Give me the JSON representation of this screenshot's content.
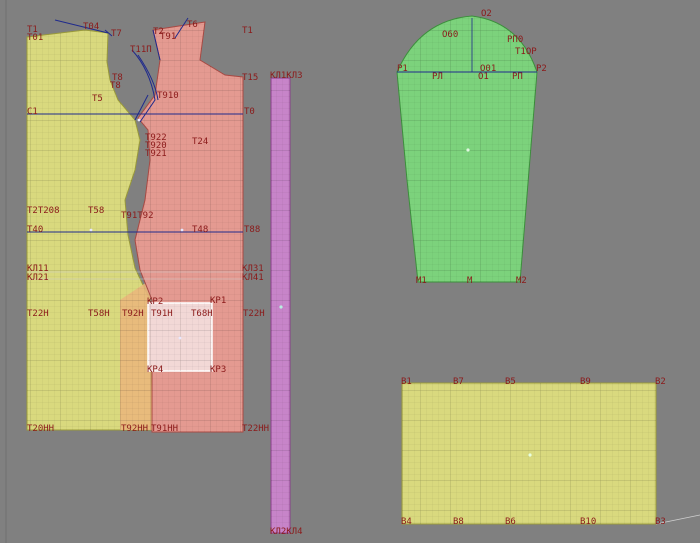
{
  "colors": {
    "background": "#808080",
    "grid_major": "#777777",
    "piece_yellow": "#d8d87a",
    "piece_red": "#e59a92",
    "piece_green": "#78d278",
    "piece_violet": "#c784c9",
    "piece_orange": "#e8b878",
    "construction_line": "#1f2a8c",
    "label": "#8b1a1a"
  },
  "pieces": {
    "back_piece": "back-bodice-piece",
    "front_piece": "front-bodice-piece",
    "sleeve_piece": "sleeve-piece",
    "strip_piece": "facing-strip-piece",
    "rect_piece": "rectangle-piece",
    "pocket": "pocket-square"
  },
  "labels": {
    "t1": "T1",
    "t01": "T01",
    "t04": "T04",
    "t7": "T7",
    "t2": "T2",
    "t6": "T6",
    "t91": "T91",
    "t1_right": "T1",
    "t11p": "T11П",
    "t8a": "T8",
    "t8b": "T8",
    "t15": "T15",
    "t5": "T5",
    "t910": "T910",
    "t0": "T0",
    "t_c": "C1",
    "t922": "T922",
    "t920": "T920",
    "t921": "T921",
    "t24": "T24",
    "t2208": "T2T208",
    "t58": "T58",
    "t913": "T91T92",
    "t40": "T40",
    "t48": "T48",
    "t88": "T88",
    "kl11": "КЛ11",
    "kl21": "КЛ21",
    "kl31": "КЛ31",
    "kl41": "КЛ41",
    "t22h_left": "T22H",
    "t58h": "T58H",
    "t92h": "T92H",
    "t91h": "T91H",
    "t68h": "T68H",
    "t22h_right": "T22H",
    "kp2": "КР2",
    "kp1": "КР1",
    "kp4": "КР4",
    "kp3": "КР3",
    "t20hh": "T20HH",
    "t92hh": "T92HH",
    "t91hh": "T91HH",
    "t22hh": "T22HH",
    "kl1_kl3": "КЛ1КЛ3",
    "kl2_kl4": "КЛ2КЛ4",
    "o2": "O2",
    "o60": "O60",
    "rp0": "РП0",
    "t10p": "T1ОР",
    "p1": "P1",
    "rl": "РЛ",
    "o01": "O01",
    "o1": "O1",
    "rp": "РП",
    "p2": "P2",
    "m1": "M1",
    "m": "M",
    "m2": "M2",
    "b1": "B1",
    "b7": "B7",
    "b5": "B5",
    "b9": "B9",
    "b2": "B2",
    "b4": "B4",
    "b8": "B8",
    "b6": "B6",
    "b10": "B10",
    "b3": "B3"
  }
}
